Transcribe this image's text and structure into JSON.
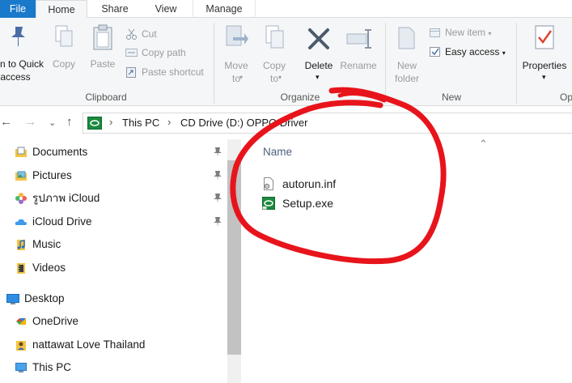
{
  "ribbon": {
    "tabs": {
      "file": "File",
      "home": "Home",
      "share": "Share",
      "view": "View",
      "manage": "Manage"
    },
    "clipboard": {
      "pin_label_1": "n to Quick",
      "pin_label_2": "access",
      "copy": "Copy",
      "paste": "Paste",
      "cut": "Cut",
      "copy_path": "Copy path",
      "paste_shortcut": "Paste shortcut",
      "group": "Clipboard"
    },
    "organize": {
      "move_to_1": "Move",
      "move_to_2": "to",
      "copy_to_1": "Copy",
      "copy_to_2": "to",
      "delete": "Delete",
      "rename": "Rename",
      "group": "Organize"
    },
    "new": {
      "new_folder_1": "New",
      "new_folder_2": "folder",
      "new_item": "New item",
      "easy_access": "Easy access",
      "group": "New"
    },
    "open": {
      "properties": "Properties",
      "group_partial": "Op"
    }
  },
  "address": {
    "this_pc": "This PC",
    "drive": "CD Drive (D:) OPPO Driver"
  },
  "nav": {
    "items": [
      {
        "label": "Documents",
        "pinned": true
      },
      {
        "label": "Pictures",
        "pinned": true
      },
      {
        "label": "รูปภาพ iCloud",
        "pinned": true
      },
      {
        "label": "iCloud Drive",
        "pinned": true
      },
      {
        "label": "Music",
        "pinned": false
      },
      {
        "label": "Videos",
        "pinned": false
      },
      {
        "label": "Desktop",
        "pinned": false
      },
      {
        "label": "OneDrive",
        "pinned": false
      },
      {
        "label": "nattawat Love Thailand",
        "pinned": false
      },
      {
        "label": "This PC",
        "pinned": false
      }
    ]
  },
  "filelist": {
    "column_name": "Name",
    "files": [
      {
        "name": "autorun.inf",
        "icon": "settings-file-icon"
      },
      {
        "name": "Setup.exe",
        "icon": "setup-app-icon"
      }
    ]
  },
  "colors": {
    "file_tab": "#1979ca",
    "annotation": "#e8141b",
    "accent": "#1979ca"
  }
}
